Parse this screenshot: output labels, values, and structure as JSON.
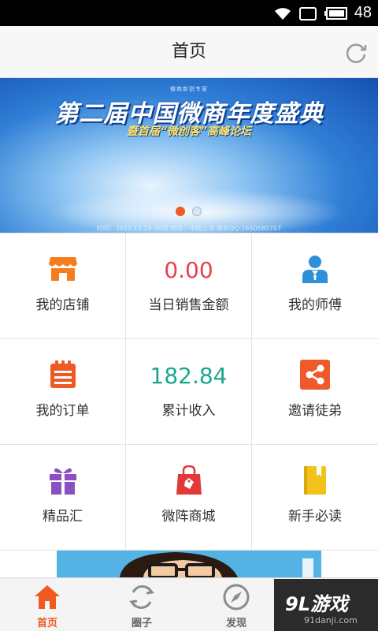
{
  "status_bar": {
    "time": "48",
    "icons": [
      "wifi-icon",
      "sim-icon",
      "battery-icon"
    ]
  },
  "header": {
    "title": "首页",
    "icon": "refresh-icon"
  },
  "banner": {
    "kicker": "微商新锐专家",
    "headline": "第二届中国微商年度盛典",
    "subline": "暨首届“微创客”高峰论坛",
    "caption": "时间：2015.12.29-30日 地点：中国上海 报名QQ:1650580707",
    "dots": 2,
    "active_dot": 1
  },
  "grid": [
    {
      "type": "icon",
      "icon": "shop-icon",
      "label": "我的店铺",
      "color": "#f57c1f"
    },
    {
      "type": "value",
      "value": "0.00",
      "label": "当日销售金额",
      "color": "#e8404c"
    },
    {
      "type": "icon",
      "icon": "mentor-icon",
      "label": "我的师傅",
      "color": "#2f8fd8"
    },
    {
      "type": "icon",
      "icon": "order-icon",
      "label": "我的订单",
      "color": "#ef5a24"
    },
    {
      "type": "value",
      "value": "182.84",
      "label": "累计收入",
      "color": "#1aa88a"
    },
    {
      "type": "icon",
      "icon": "share-icon",
      "label": "邀请徒弟",
      "color": "#ee5a2a"
    },
    {
      "type": "icon",
      "icon": "gift-icon",
      "label": "精品汇",
      "color": "#8a4fc2"
    },
    {
      "type": "icon",
      "icon": "shopping-bag-icon",
      "label": "微阵商城",
      "color": "#e23838"
    },
    {
      "type": "icon",
      "icon": "book-icon",
      "label": "新手必读",
      "color": "#f2c21a"
    }
  ],
  "bottom_nav": [
    {
      "label": "首页",
      "icon": "home-icon",
      "active": true
    },
    {
      "label": "圈子",
      "icon": "circle-icon",
      "active": false
    },
    {
      "label": "发现",
      "icon": "compass-icon",
      "active": false
    }
  ],
  "watermark": {
    "main": "9L游戏",
    "sub": "91danji.com"
  },
  "colors": {
    "accent": "#f05a22",
    "header_bg": "#f7f7f7",
    "status_bg": "#000000"
  }
}
